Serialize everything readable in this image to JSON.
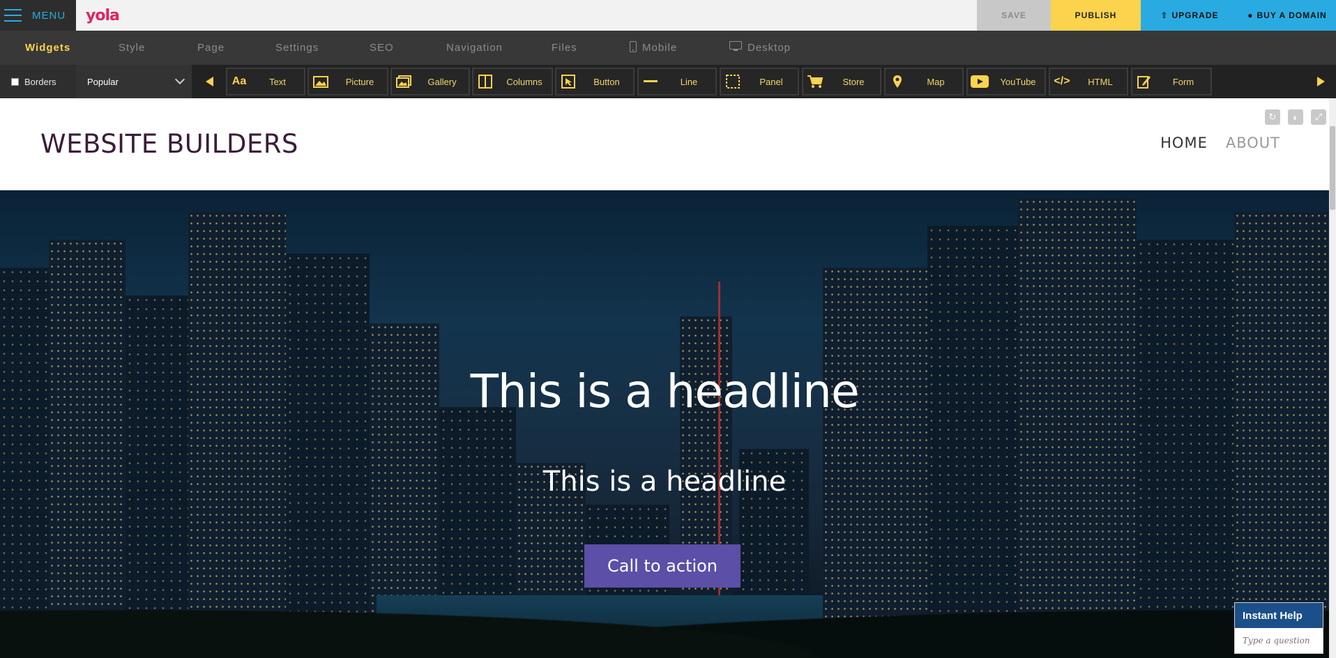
{
  "topbar": {
    "menu_label": "MENU",
    "logo_text": "yola",
    "save_label": "SAVE",
    "publish_label": "PUBLISH",
    "upgrade_label": "UPGRADE",
    "domain_label": "BUY A DOMAIN"
  },
  "tabs": [
    {
      "label": "Widgets",
      "active": true
    },
    {
      "label": "Style"
    },
    {
      "label": "Page"
    },
    {
      "label": "Settings"
    },
    {
      "label": "SEO"
    },
    {
      "label": "Navigation"
    },
    {
      "label": "Files"
    },
    {
      "label": "Mobile",
      "icon": "mobile-icon"
    },
    {
      "label": "Desktop",
      "icon": "desktop-icon"
    }
  ],
  "widgetbar": {
    "borders_label": "Borders",
    "category_selected": "Popular",
    "widgets": [
      {
        "label": "Text",
        "icon": "text-icon"
      },
      {
        "label": "Picture",
        "icon": "picture-icon"
      },
      {
        "label": "Gallery",
        "icon": "gallery-icon"
      },
      {
        "label": "Columns",
        "icon": "columns-icon"
      },
      {
        "label": "Button",
        "icon": "button-icon"
      },
      {
        "label": "Line",
        "icon": "line-icon"
      },
      {
        "label": "Panel",
        "icon": "panel-icon"
      },
      {
        "label": "Store",
        "icon": "cart-icon"
      },
      {
        "label": "Map",
        "icon": "map-pin-icon"
      },
      {
        "label": "YouTube",
        "icon": "youtube-icon"
      },
      {
        "label": "HTML",
        "icon": "code-icon"
      },
      {
        "label": "Form",
        "icon": "form-icon"
      }
    ]
  },
  "site": {
    "title": "WEBSITE BUILDERS",
    "nav": [
      {
        "label": "HOME",
        "current": true
      },
      {
        "label": "ABOUT"
      }
    ],
    "hero": {
      "headline": "This is a headline",
      "subheadline": "This is a headline",
      "cta_label": "Call to action"
    }
  },
  "help": {
    "title": "Instant Help",
    "placeholder": "Type a question"
  },
  "colors": {
    "accent_yellow": "#fcd34d",
    "accent_blue": "#29abe2",
    "brand_pink": "#e0245e",
    "cta_purple": "#5b4fa8"
  }
}
